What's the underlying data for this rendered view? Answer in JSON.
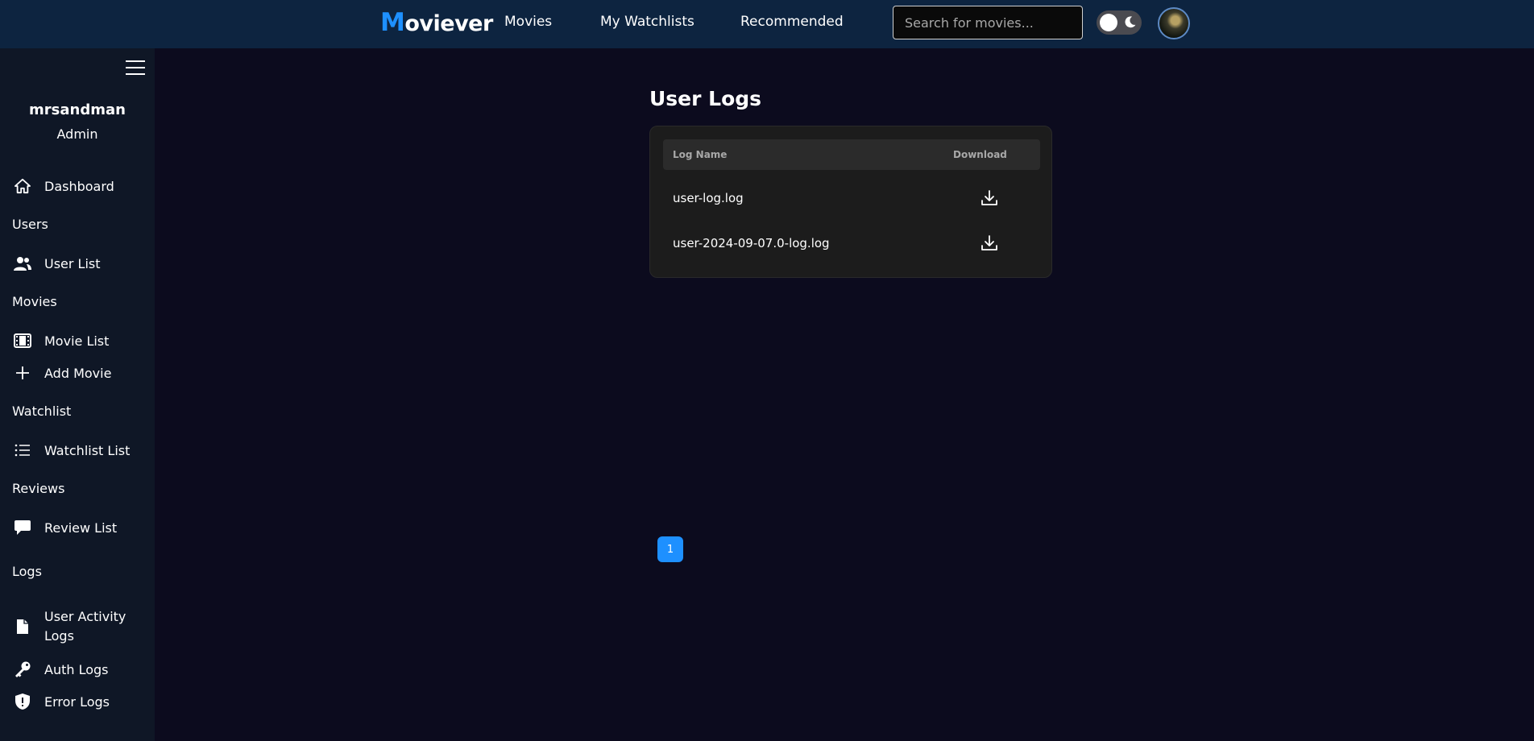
{
  "header": {
    "brand_initial": "M",
    "brand_rest": "oviever",
    "nav": [
      "Movies",
      "My Watchlists",
      "Recommended"
    ],
    "search_placeholder": "Search for movies...",
    "theme_toggle_icon": "moon-icon",
    "accent_color": "#1e90ff"
  },
  "sidebar": {
    "username": "mrsandman",
    "role": "Admin",
    "dashboard": {
      "label": "Dashboard",
      "icon": "home-icon"
    },
    "sections": {
      "users": "Users",
      "movies": "Movies",
      "watchlist": "Watchlist",
      "reviews": "Reviews",
      "logs": "Logs"
    },
    "items": {
      "user_list": {
        "label": "User List",
        "icon": "users-icon"
      },
      "movie_list": {
        "label": "Movie List",
        "icon": "film-icon"
      },
      "add_movie": {
        "label": "Add Movie",
        "icon": "plus-icon"
      },
      "watchlist_list": {
        "label": "Watchlist List",
        "icon": "list-icon"
      },
      "review_list": {
        "label": "Review List",
        "icon": "comment-icon"
      },
      "user_activity_logs": {
        "label": "User Activity Logs",
        "icon": "file-icon"
      },
      "auth_logs": {
        "label": "Auth Logs",
        "icon": "key-icon"
      },
      "error_logs": {
        "label": "Error Logs",
        "icon": "shield-alert-icon"
      }
    }
  },
  "main": {
    "title": "User Logs",
    "table": {
      "columns": [
        "Log Name",
        "Download"
      ],
      "rows": [
        {
          "name": "user-log.log"
        },
        {
          "name": "user-2024-09-07.0-log.log"
        }
      ]
    },
    "pagination": {
      "current_page": "1"
    }
  }
}
